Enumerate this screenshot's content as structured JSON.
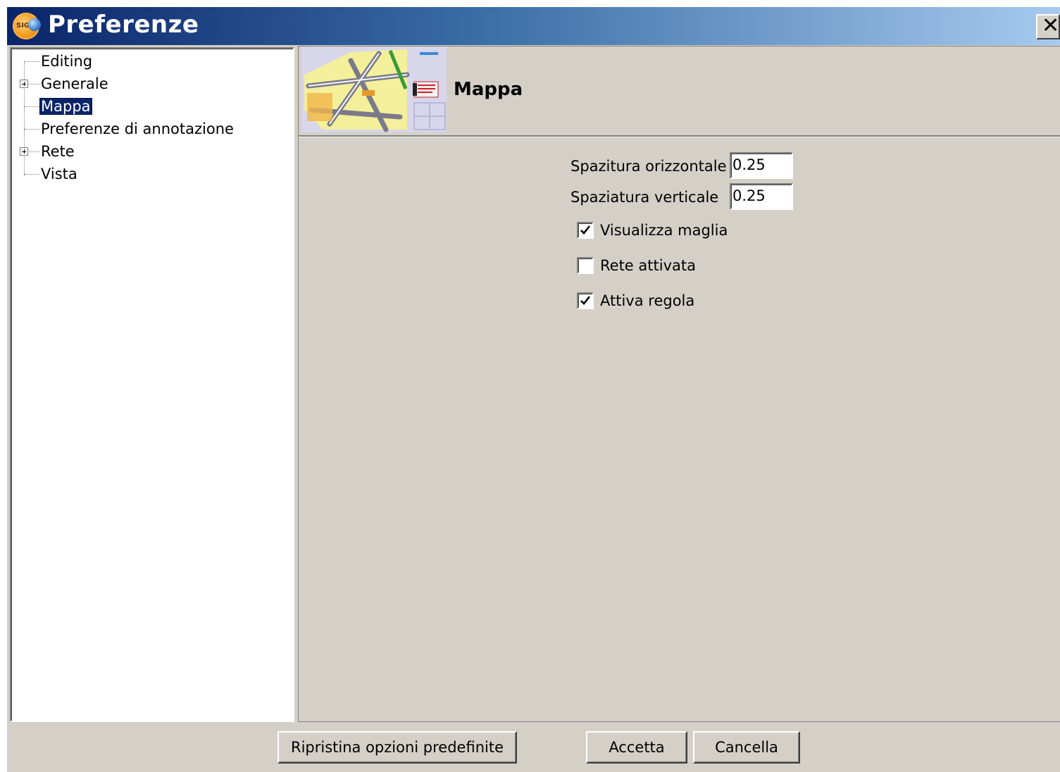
{
  "window": {
    "title": "Preferenze",
    "icon": "app-logo-icon",
    "close_symbol": "✕"
  },
  "tree": {
    "items": [
      {
        "label": "Editing",
        "expandable": false,
        "selected": false
      },
      {
        "label": "Generale",
        "expandable": true,
        "selected": false
      },
      {
        "label": "Mappa",
        "expandable": false,
        "selected": true
      },
      {
        "label": "Preferenze di annotazione",
        "expandable": false,
        "selected": false
      },
      {
        "label": "Rete",
        "expandable": true,
        "selected": false
      },
      {
        "label": "Vista",
        "expandable": false,
        "selected": false
      }
    ]
  },
  "panel": {
    "title": "Mappa",
    "header_image": "map-thumbnail-icon",
    "fields": {
      "horizontal_label": "Spazitura orizzontale",
      "horizontal_value": "0.25",
      "vertical_label": "Spaziatura verticale",
      "vertical_value": "0.25"
    },
    "checkboxes": [
      {
        "label": "Visualizza maglia",
        "checked": true
      },
      {
        "label": "Rete attivata",
        "checked": false
      },
      {
        "label": "Attiva regola",
        "checked": true
      }
    ]
  },
  "buttons": {
    "restore_label": "Ripristina opzioni predefinite",
    "accept_label": "Accetta",
    "cancel_label": "Cancella"
  },
  "colors": {
    "titlebar_start": "#0a246a",
    "titlebar_end": "#a6caf0",
    "dialog_bg": "#d4d0c8",
    "selection": "#0a246a"
  }
}
